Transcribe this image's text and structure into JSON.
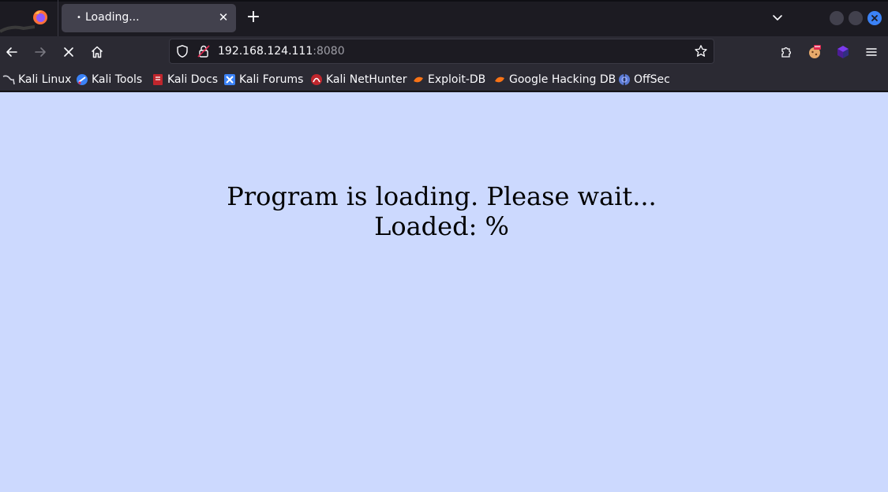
{
  "browser": {
    "tab": {
      "title": "Loading...",
      "loading_dot": "•"
    },
    "new_tab_symbol": "+",
    "tab_close_symbol": "✕",
    "accent_color": "#3b82f6"
  },
  "nav": {
    "url_host": "192.168.124.111",
    "url_port": ":8080"
  },
  "bookmarks": [
    {
      "label": "Kali Linux",
      "icon": "kali-dragon-icon"
    },
    {
      "label": "Kali Tools",
      "icon": "kali-tools-icon"
    },
    {
      "label": "Kali Docs",
      "icon": "kali-docs-icon"
    },
    {
      "label": "Kali Forums",
      "icon": "kali-forums-icon"
    },
    {
      "label": "Kali NetHunter",
      "icon": "nethunter-icon"
    },
    {
      "label": "Exploit-DB",
      "icon": "exploit-db-icon"
    },
    {
      "label": "Google Hacking DB",
      "icon": "ghdb-icon"
    },
    {
      "label": "OffSec",
      "icon": "offsec-icon"
    }
  ],
  "page": {
    "background": "#ccd9fe",
    "line1": "Program is loading. Please wait...",
    "line2": "Loaded: %"
  }
}
